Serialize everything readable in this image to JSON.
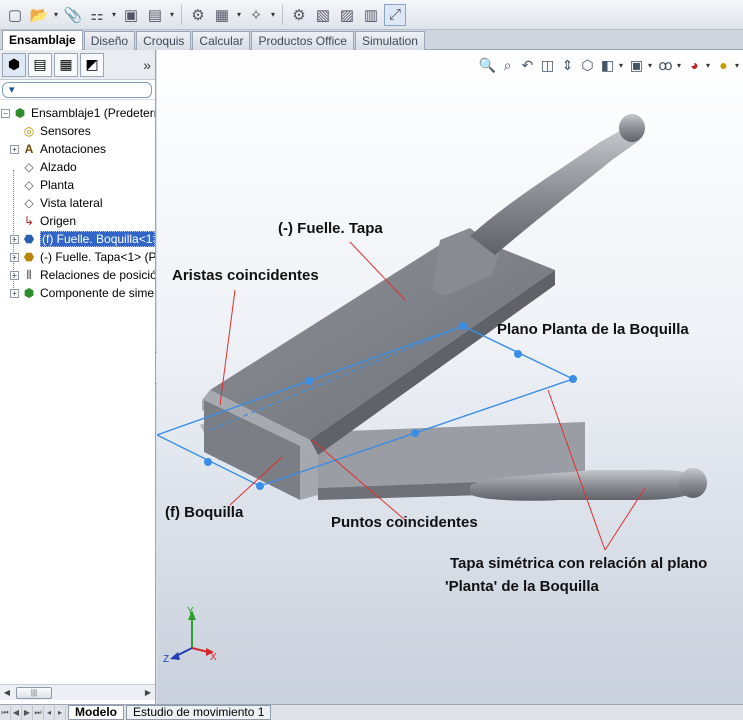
{
  "toolbar": {
    "buttons": [
      "new-icon",
      "open-icon",
      "properties-icon",
      "insert-components-icon",
      "mate-icon",
      "linear-pattern-icon",
      "smart-fasteners-icon",
      "move-component-icon",
      "show-hidden-icon",
      "assembly-features-icon",
      "reference-geometry-icon",
      "new-motion-study-icon",
      "bill-of-materials-icon",
      "exploded-view-icon",
      "explode-line-icon",
      "interference-icon"
    ]
  },
  "tabs": [
    "Ensamblaje",
    "Diseño",
    "Croquis",
    "Calcular",
    "Productos Office",
    "Simulation"
  ],
  "active_tab": "Ensamblaje",
  "panel": {
    "more": "»",
    "filter": "▾",
    "tree": [
      {
        "label": "Ensamblaje1  (Predeterm",
        "icon": "assembly-icon",
        "level": 0,
        "expander": "−"
      },
      {
        "label": "Sensores",
        "icon": "sensor-icon",
        "level": 1,
        "expander": ""
      },
      {
        "label": "Anotaciones",
        "icon": "annotation-icon",
        "level": 1,
        "expander": "+"
      },
      {
        "label": "Alzado",
        "icon": "plane-icon",
        "level": 1,
        "expander": ""
      },
      {
        "label": "Planta",
        "icon": "plane-icon",
        "level": 1,
        "expander": ""
      },
      {
        "label": "Vista lateral",
        "icon": "plane-icon",
        "level": 1,
        "expander": ""
      },
      {
        "label": "Origen",
        "icon": "origin-icon",
        "level": 1,
        "expander": ""
      },
      {
        "label": "(f) Fuelle. Boquilla<1>",
        "icon": "part-icon",
        "level": 1,
        "expander": "+",
        "selected": true
      },
      {
        "label": "(-) Fuelle. Tapa<1> (P",
        "icon": "part-icon",
        "level": 1,
        "expander": "+"
      },
      {
        "label": "Relaciones de posició",
        "icon": "mates-icon",
        "level": 1,
        "expander": "+"
      },
      {
        "label": "Componente de sime",
        "icon": "mirror-component-icon",
        "level": 1,
        "expander": "+"
      }
    ]
  },
  "view_tools": [
    "zoom-to-fit-icon",
    "zoom-to-area-icon",
    "previous-view-icon",
    "section-view-icon",
    "dynamic-annotation-icon",
    "view-orientation-icon",
    "display-style-icon",
    "hide-show-items-icon",
    "edit-appearance-icon",
    "apply-scene-icon",
    "view-settings-icon"
  ],
  "annotations": {
    "tapa": "(-) Fuelle. Tapa",
    "aristas": "Aristas coincidentes",
    "plano": "Plano Planta de la Boquilla",
    "boquilla": "(f) Boquilla",
    "puntos": "Puntos coincidentes",
    "simetrica_1": "Tapa simétrica con relación al plano",
    "simetrica_2": "'Planta' de la Boquilla"
  },
  "triad": {
    "x": "X",
    "y": "Y",
    "z": "Z"
  },
  "colors": {
    "plane": "#3a8ee6",
    "leader": "#e03030",
    "part": "#8a8d93",
    "selection": "#3165c7"
  },
  "bottom_tabs": [
    "Modelo",
    "Estudio de movimiento 1"
  ],
  "active_bottom_tab": "Modelo"
}
